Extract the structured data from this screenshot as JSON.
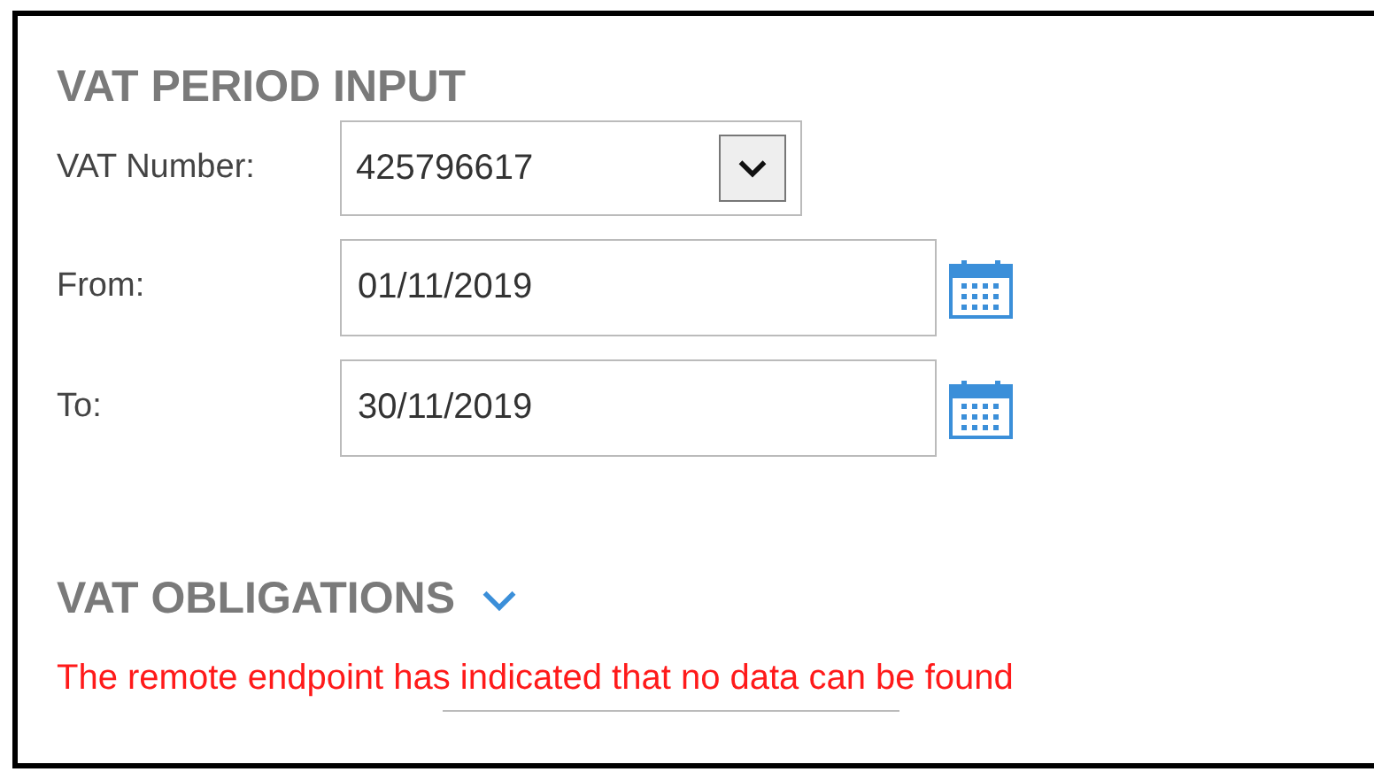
{
  "period_section": {
    "title": "VAT PERIOD INPUT"
  },
  "fields": [
    {
      "kind": "select",
      "label": "VAT Number:",
      "value": "425796617"
    },
    {
      "kind": "date",
      "label": "From:",
      "value": "01/11/2019"
    },
    {
      "kind": "date",
      "label": "To:",
      "value": "30/11/2019"
    }
  ],
  "obligations_section": {
    "title": "VAT OBLIGATIONS",
    "expanded": true,
    "error": "The remote endpoint has indicated that no data can be found"
  }
}
